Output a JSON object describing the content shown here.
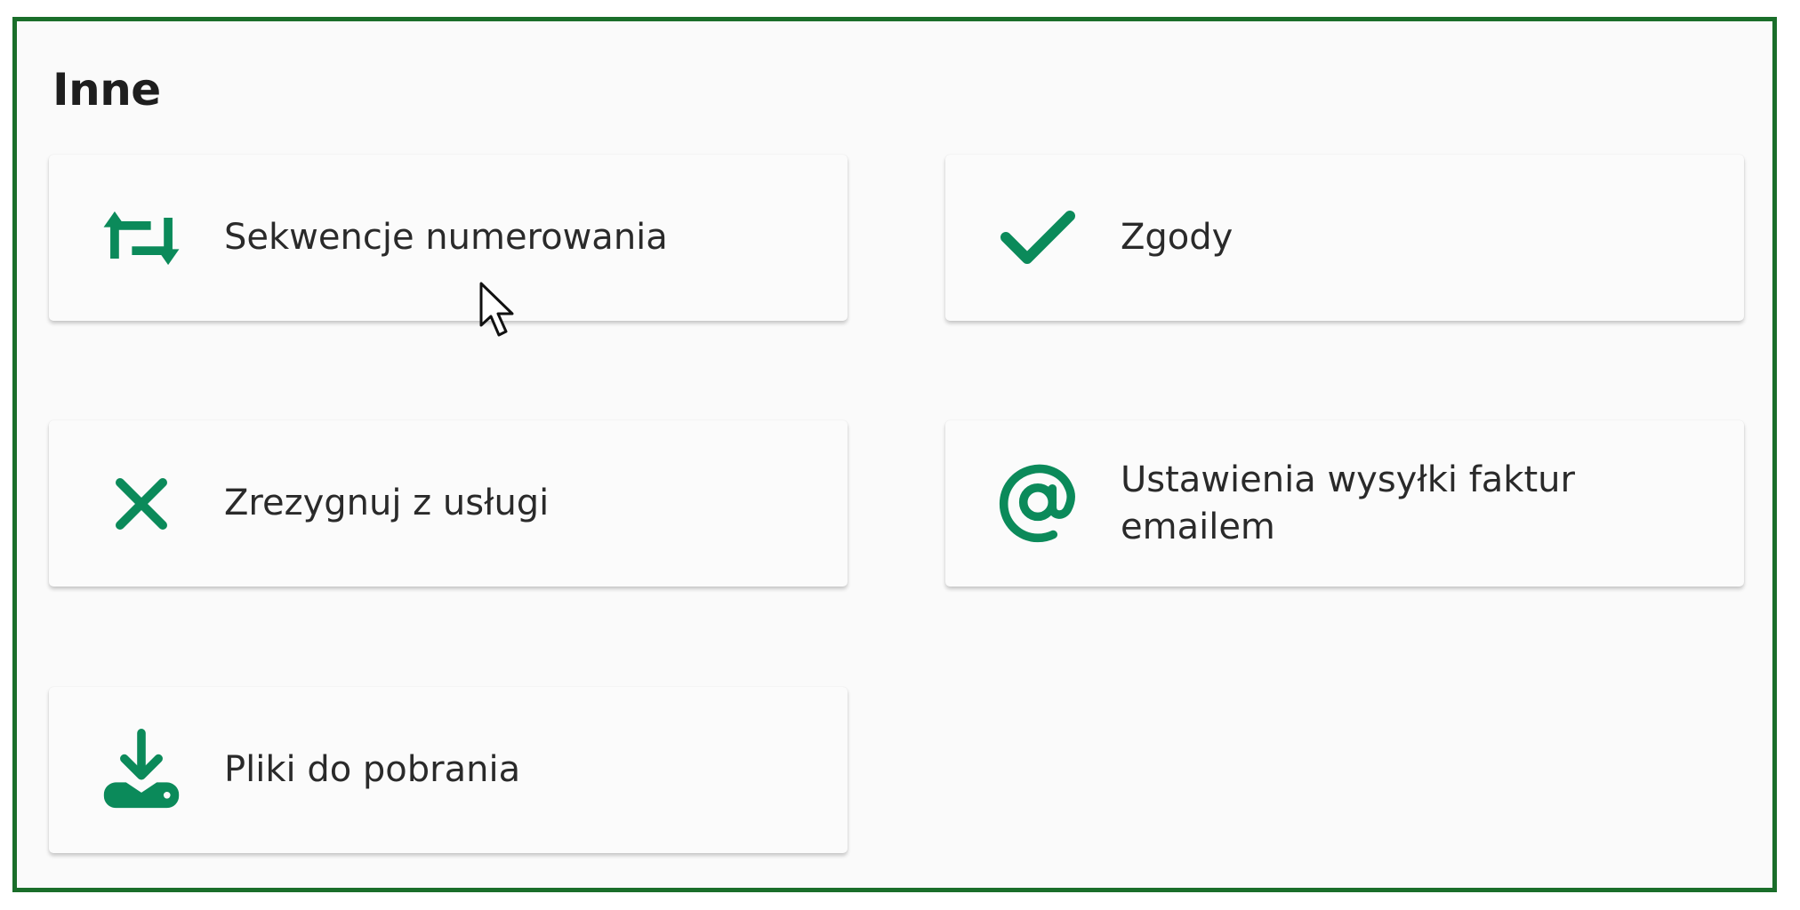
{
  "section": {
    "title": "Inne"
  },
  "cards": [
    {
      "label": "Sekwencje numerowania",
      "icon": "repeat-arrows-icon"
    },
    {
      "label": "Zgody",
      "icon": "checkmark-icon"
    },
    {
      "label": "Zrezygnuj z usługi",
      "icon": "close-x-icon"
    },
    {
      "label": "Ustawienia wysyłki faktur emailem",
      "icon": "at-sign-icon"
    },
    {
      "label": "Pliki do pobrania",
      "icon": "download-tray-icon"
    }
  ],
  "colors": {
    "accent": "#0b8a5a",
    "frame_border": "#1a6e2a",
    "text": "#2a2a2a",
    "card_bg": "#fbfbfb"
  }
}
